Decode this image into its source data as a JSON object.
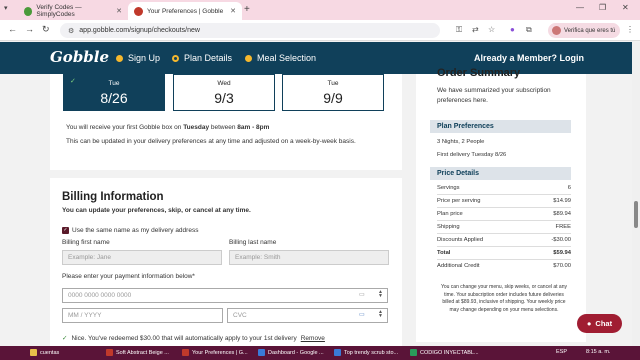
{
  "browser": {
    "tabs": [
      {
        "title": "Verify Codes — SimplyCodes",
        "active": false
      },
      {
        "title": "Your Preferences | Gobble",
        "active": true
      }
    ],
    "url": "app.gobble.com/signup/checkouts/new",
    "profile_label": "Verifica que eres tú"
  },
  "header": {
    "logo": "Gobble",
    "nav": [
      {
        "label": "Sign Up"
      },
      {
        "label": "Plan Details"
      },
      {
        "label": "Meal Selection"
      }
    ],
    "member_link": "Already a Member? Login"
  },
  "delivery": {
    "dates": [
      {
        "day": "Tue",
        "date": "8/26",
        "selected": true
      },
      {
        "day": "Wed",
        "date": "9/3",
        "selected": false
      },
      {
        "day": "Tue",
        "date": "9/9",
        "selected": false
      }
    ],
    "first_box_prefix": "You will receive your first Gobble box on ",
    "first_box_day": "Tuesday",
    "first_box_between": " between ",
    "first_box_time": "8am - 8pm",
    "update_note": "This can be updated in your delivery preferences at any time and adjusted on a week-by-week basis."
  },
  "billing": {
    "title": "Billing Information",
    "subtitle": "You can update your preferences, skip, or cancel at any time.",
    "same_address_label": "Use the same name as my delivery address",
    "first_name_label": "Billing first name",
    "first_name_placeholder": "Example: Jane",
    "last_name_label": "Billing last name",
    "last_name_placeholder": "Example: Smith",
    "payment_label": "Please enter your payment information below*",
    "card_placeholder": "0000 0000 0000 0000",
    "expiry_placeholder": "MM / YYYY",
    "cvc_placeholder": "CVC",
    "redeemed_text": "Nice. You've redeemed $30.00 that will automatically apply to your 1st delivery",
    "remove_label": "Remove"
  },
  "summary": {
    "title": "Order Summary",
    "description": "We have summarized your subscription preferences here.",
    "plan_heading": "Plan Preferences",
    "plan_lines": [
      "3 Nights, 2 People",
      "First delivery Tuesday 8/26"
    ],
    "price_heading": "Price Details",
    "price_rows": [
      {
        "label": "Servings",
        "value": "6"
      },
      {
        "label": "Price per serving",
        "value": "$14.99"
      },
      {
        "label": "Plan price",
        "value": "$89.94"
      },
      {
        "label": "Shipping",
        "value": "FREE"
      },
      {
        "label": "Discounts Applied",
        "value": "-$30.00"
      },
      {
        "label": "Total",
        "value": "$59.94"
      },
      {
        "label": "Additional Credit",
        "value": "$70.00"
      }
    ],
    "fine_print": "You can change your menu, skip weeks, or cancel at any time. Your subscription order includes future deliveries billed at $89.93, inclusive of shipping. Your weekly price may change depending on your menu selections."
  },
  "chat": {
    "label": "Chat"
  },
  "taskbar": {
    "items": [
      {
        "label": "cuentas"
      },
      {
        "label": "Soft Abstract Beige ..."
      },
      {
        "label": "Your Preferences | G..."
      },
      {
        "label": "Dashboard - Google ..."
      },
      {
        "label": "Top trendy scrub sto..."
      },
      {
        "label": "CODIGO INYECTABL..."
      }
    ],
    "lang": "ESP",
    "time": "8:15 a. m."
  },
  "colors": {
    "brand_navy": "#10405a",
    "accent_gold": "#f5b82e",
    "chat_red": "#a01d32",
    "taskbar": "#5a1438"
  }
}
